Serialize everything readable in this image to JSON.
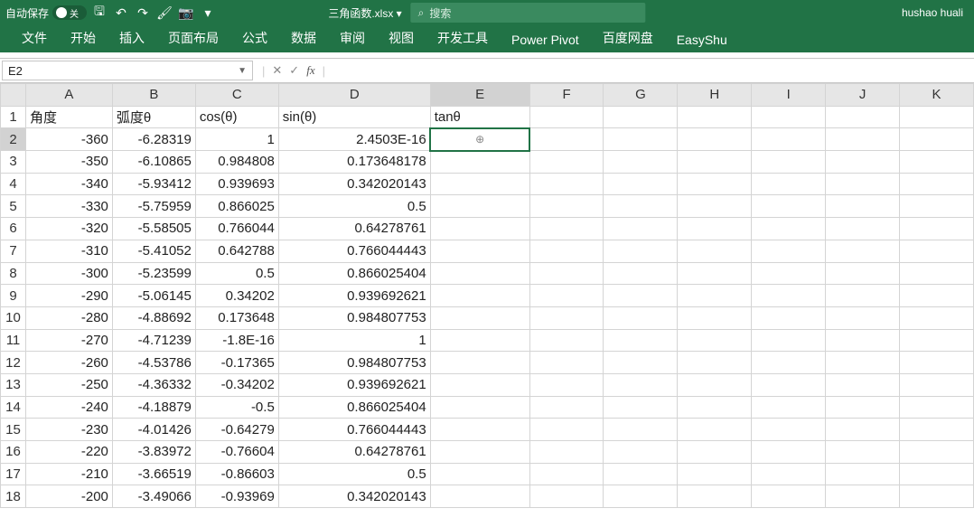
{
  "titlebar": {
    "autosave_label": "自动保存",
    "toggle_text": "关",
    "doc_name": "三角函数.xlsx  ▾",
    "search_placeholder": "搜索",
    "user_name": "hushao huali"
  },
  "qat": {
    "save": "🖫",
    "undo": "↶",
    "redo": "↷",
    "brush": "🖌",
    "camera": "📷",
    "more": "▾"
  },
  "ribbon": {
    "tabs": [
      "文件",
      "开始",
      "插入",
      "页面布局",
      "公式",
      "数据",
      "审阅",
      "视图",
      "开发工具",
      "Power Pivot",
      "百度网盘",
      "EasyShu"
    ]
  },
  "fx": {
    "namebox": "E2",
    "cancel": "✕",
    "confirm": "✓",
    "fx": "fx",
    "value": ""
  },
  "columns": [
    "A",
    "B",
    "C",
    "D",
    "E",
    "F",
    "G",
    "H",
    "I",
    "J",
    "K"
  ],
  "headers": {
    "A": "角度",
    "B": "弧度θ",
    "C": "cos(θ)",
    "D": "sin(θ)",
    "E": "tanθ"
  },
  "rows": [
    {
      "n": 2,
      "A": "-360",
      "B": "-6.28319",
      "C": "1",
      "D": "2.4503E-16"
    },
    {
      "n": 3,
      "A": "-350",
      "B": "-6.10865",
      "C": "0.984808",
      "D": "0.173648178"
    },
    {
      "n": 4,
      "A": "-340",
      "B": "-5.93412",
      "C": "0.939693",
      "D": "0.342020143"
    },
    {
      "n": 5,
      "A": "-330",
      "B": "-5.75959",
      "C": "0.866025",
      "D": "0.5"
    },
    {
      "n": 6,
      "A": "-320",
      "B": "-5.58505",
      "C": "0.766044",
      "D": "0.64278761"
    },
    {
      "n": 7,
      "A": "-310",
      "B": "-5.41052",
      "C": "0.642788",
      "D": "0.766044443"
    },
    {
      "n": 8,
      "A": "-300",
      "B": "-5.23599",
      "C": "0.5",
      "D": "0.866025404"
    },
    {
      "n": 9,
      "A": "-290",
      "B": "-5.06145",
      "C": "0.34202",
      "D": "0.939692621"
    },
    {
      "n": 10,
      "A": "-280",
      "B": "-4.88692",
      "C": "0.173648",
      "D": "0.984807753"
    },
    {
      "n": 11,
      "A": "-270",
      "B": "-4.71239",
      "C": "-1.8E-16",
      "D": "1"
    },
    {
      "n": 12,
      "A": "-260",
      "B": "-4.53786",
      "C": "-0.17365",
      "D": "0.984807753"
    },
    {
      "n": 13,
      "A": "-250",
      "B": "-4.36332",
      "C": "-0.34202",
      "D": "0.939692621"
    },
    {
      "n": 14,
      "A": "-240",
      "B": "-4.18879",
      "C": "-0.5",
      "D": "0.866025404"
    },
    {
      "n": 15,
      "A": "-230",
      "B": "-4.01426",
      "C": "-0.64279",
      "D": "0.766044443"
    },
    {
      "n": 16,
      "A": "-220",
      "B": "-3.83972",
      "C": "-0.76604",
      "D": "0.64278761"
    },
    {
      "n": 17,
      "A": "-210",
      "B": "-3.66519",
      "C": "-0.86603",
      "D": "0.5"
    },
    {
      "n": 18,
      "A": "-200",
      "B": "-3.49066",
      "C": "-0.93969",
      "D": "0.342020143"
    }
  ],
  "selection": {
    "cell": "E2",
    "cursor": "⊕"
  }
}
